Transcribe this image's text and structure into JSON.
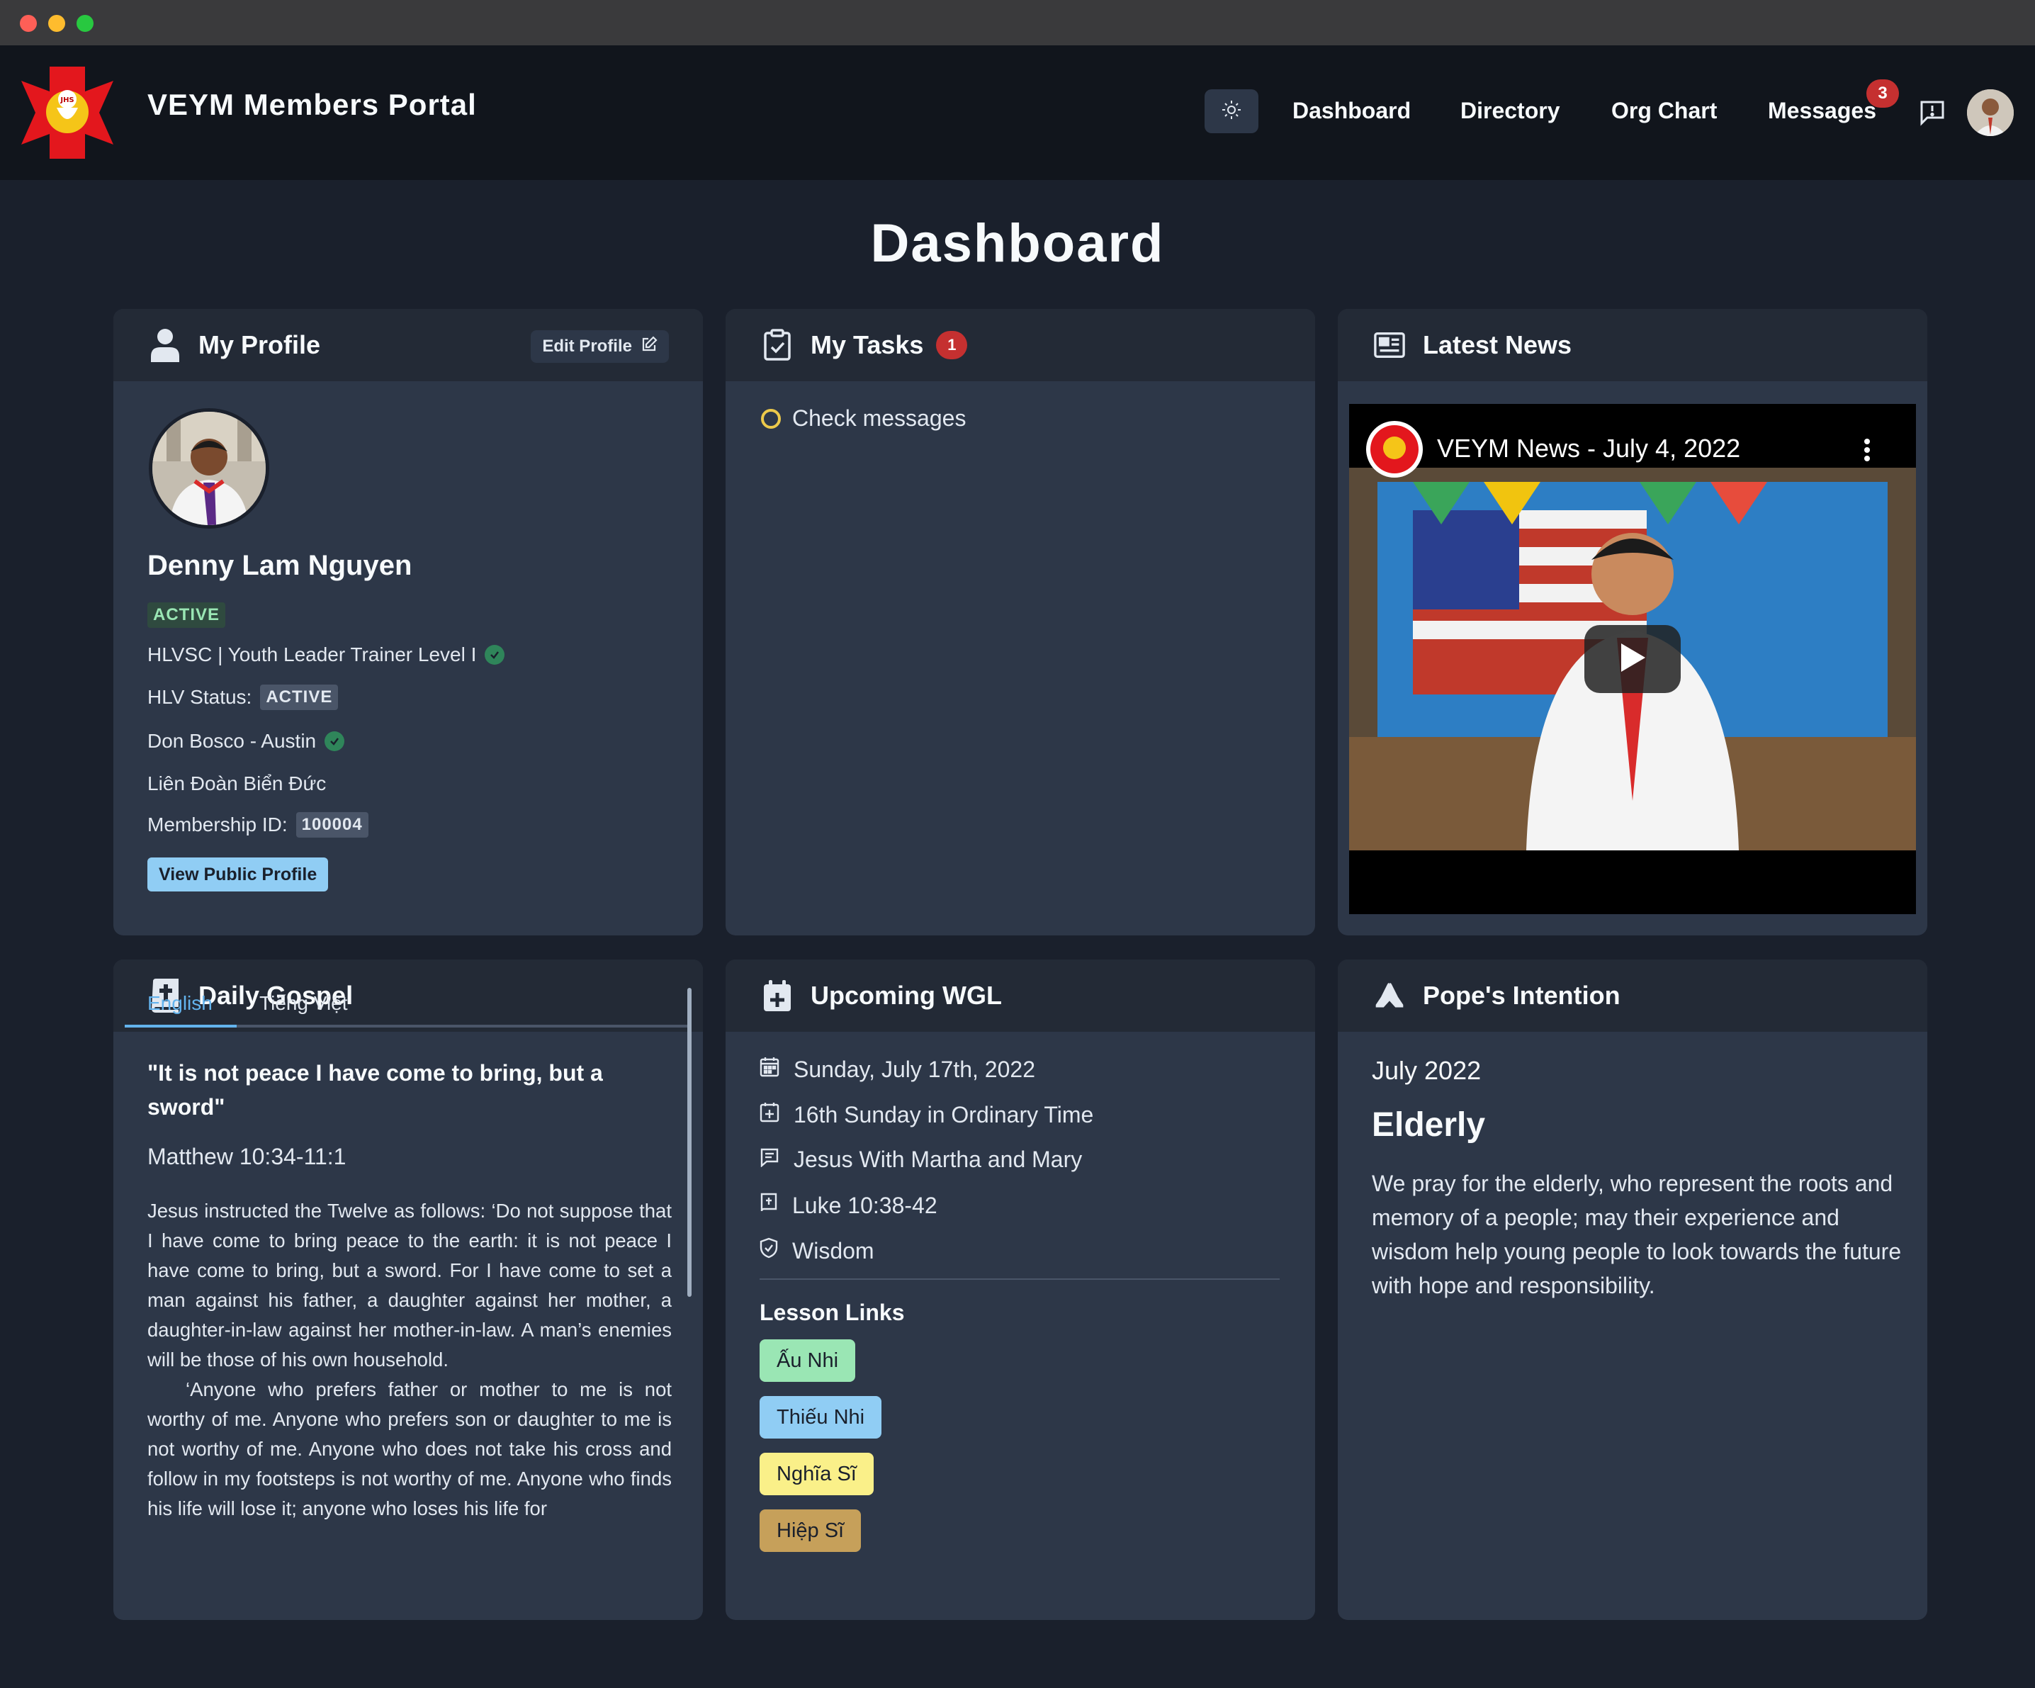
{
  "window": {
    "controls": [
      "close",
      "minimize",
      "maximize"
    ]
  },
  "nav": {
    "brand": "VEYM Members Portal",
    "logo_text": "JHS",
    "links": [
      "Dashboard",
      "Directory",
      "Org Chart",
      "Messages"
    ],
    "messages_badge": "3",
    "theme_icon": "sun-icon",
    "feedback_icon": "message-alert-icon"
  },
  "page": {
    "title": "Dashboard"
  },
  "profile": {
    "title": "My Profile",
    "edit_label": "Edit Profile",
    "name": "Denny Lam Nguyen",
    "status": "ACTIVE",
    "training": "HLVSC | Youth Leader Trainer Level I",
    "hlv_label": "HLV Status:",
    "hlv_status": "ACTIVE",
    "chapter": "Don Bosco - Austin",
    "league": "Liên Đoàn Biển Đức",
    "membership_label": "Membership ID:",
    "membership_id": "100004",
    "view_public": "View Public Profile"
  },
  "tasks": {
    "title": "My Tasks",
    "count": "1",
    "items": [
      "Check messages"
    ]
  },
  "news": {
    "title": "Latest News",
    "video_title": "VEYM News - July 4, 2022"
  },
  "gospel": {
    "title": "Daily Gospel",
    "tabs": [
      "English",
      "Tiếng Việt"
    ],
    "active_tab": "English",
    "quote": "\"It is not peace I have come to bring, but a sword\"",
    "reference": "Matthew 10:34-11:1",
    "paragraph1": "Jesus instructed the Twelve as follows: ‘Do not suppose that I have come to bring peace to the earth: it is not peace I have come to bring, but a sword. For I have come to set a man against his father, a daughter against her mother, a daughter-in-law against her mother-in-law. A man’s enemies will be those of his own household.",
    "paragraph2": "‘Anyone who prefers father or mother to me is not worthy of me. Anyone who prefers son or daughter to me is not worthy of me. Anyone who does not take his cross and follow in my footsteps is not worthy of me. Anyone who finds his life will lose it; anyone who loses his life for"
  },
  "wgl": {
    "title": "Upcoming WGL",
    "date": "Sunday, July 17th, 2022",
    "liturgy": "16th Sunday in Ordinary Time",
    "theme": "Jesus With Martha and Mary",
    "reading": "Luke 10:38-42",
    "virtue": "Wisdom",
    "lesson_title": "Lesson Links",
    "lessons": [
      {
        "label": "Ấu Nhi",
        "color": "#9ae6b4"
      },
      {
        "label": "Thiếu Nhi",
        "color": "#90cdf4"
      },
      {
        "label": "Nghĩa Sĩ",
        "color": "#faf089"
      },
      {
        "label": "Hiệp Sĩ",
        "color": "#c6a05a"
      }
    ]
  },
  "pope": {
    "title": "Pope's Intention",
    "month": "July 2022",
    "heading": "Elderly",
    "text": "We pray for the elderly, who represent the roots and memory of a people; may their experience and wisdom help young people to look towards the future with hope and responsibility."
  }
}
